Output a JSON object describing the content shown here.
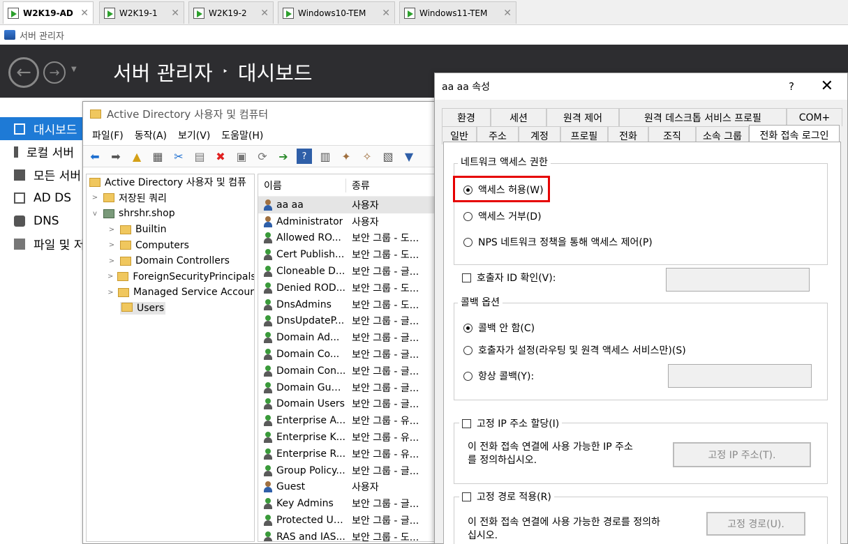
{
  "vm_tabs": [
    {
      "label": "W2K19-AD"
    },
    {
      "label": "W2K19-1"
    },
    {
      "label": "W2K19-2"
    },
    {
      "label": "Windows10-TEM"
    },
    {
      "label": "Windows11-TEM"
    }
  ],
  "server_manager": {
    "window_title": "서버 관리자",
    "header_app": "서버 관리자",
    "header_sep": "‣",
    "header_page": "대시보드",
    "nav": [
      {
        "label": "대시보드"
      },
      {
        "label": "로컬 서버"
      },
      {
        "label": "모든 서버"
      },
      {
        "label": "AD DS"
      },
      {
        "label": "DNS"
      },
      {
        "label": "파일 및 저"
      }
    ]
  },
  "aduc": {
    "title": "Active Directory 사용자 및 컴퓨터",
    "menu": [
      "파일(F)",
      "동작(A)",
      "보기(V)",
      "도움말(H)"
    ],
    "tree": [
      {
        "label": "Active Directory 사용자 및 컴퓨",
        "indent": 0,
        "chevron": ""
      },
      {
        "label": "저장된 쿼리",
        "indent": 1,
        "chevron": ">"
      },
      {
        "label": "shrshr.shop",
        "indent": 1,
        "chevron": "v"
      },
      {
        "label": "Builtin",
        "indent": 2,
        "chevron": ">"
      },
      {
        "label": "Computers",
        "indent": 2,
        "chevron": ">"
      },
      {
        "label": "Domain Controllers",
        "indent": 2,
        "chevron": ">"
      },
      {
        "label": "ForeignSecurityPrincipals",
        "indent": 2,
        "chevron": ">"
      },
      {
        "label": "Managed Service Accour",
        "indent": 2,
        "chevron": ">"
      },
      {
        "label": "Users",
        "indent": 2,
        "chevron": ""
      }
    ],
    "columns": {
      "name": "이름",
      "type": "종류"
    },
    "rows": [
      {
        "name": "aa aa",
        "type": "사용자",
        "kind": "user"
      },
      {
        "name": "Administrator",
        "type": "사용자",
        "kind": "user"
      },
      {
        "name": "Allowed RO...",
        "type": "보안 그룹 - 도...",
        "kind": "group"
      },
      {
        "name": "Cert Publish...",
        "type": "보안 그룹 - 도...",
        "kind": "group"
      },
      {
        "name": "Cloneable D...",
        "type": "보안 그룹 - 글...",
        "kind": "group"
      },
      {
        "name": "Denied ROD...",
        "type": "보안 그룹 - 도...",
        "kind": "group"
      },
      {
        "name": "DnsAdmins",
        "type": "보안 그룹 - 도...",
        "kind": "group"
      },
      {
        "name": "DnsUpdateP...",
        "type": "보안 그룹 - 글...",
        "kind": "group"
      },
      {
        "name": "Domain Ad...",
        "type": "보안 그룹 - 글...",
        "kind": "group"
      },
      {
        "name": "Domain Co...",
        "type": "보안 그룹 - 글...",
        "kind": "group"
      },
      {
        "name": "Domain Con...",
        "type": "보안 그룹 - 글...",
        "kind": "group"
      },
      {
        "name": "Domain Gue...",
        "type": "보안 그룹 - 글...",
        "kind": "group"
      },
      {
        "name": "Domain Users",
        "type": "보안 그룹 - 글...",
        "kind": "group"
      },
      {
        "name": "Enterprise A...",
        "type": "보안 그룹 - 유...",
        "kind": "group"
      },
      {
        "name": "Enterprise K...",
        "type": "보안 그룹 - 유...",
        "kind": "group"
      },
      {
        "name": "Enterprise R...",
        "type": "보안 그룹 - 유...",
        "kind": "group"
      },
      {
        "name": "Group Policy...",
        "type": "보안 그룹 - 글...",
        "kind": "group"
      },
      {
        "name": "Guest",
        "type": "사용자",
        "kind": "user"
      },
      {
        "name": "Key Admins",
        "type": "보안 그룹 - 글...",
        "kind": "group"
      },
      {
        "name": "Protected Us...",
        "type": "보안 그룹 - 글...",
        "kind": "group"
      },
      {
        "name": "RAS and IAS...",
        "type": "보안 그룹 - 도...",
        "kind": "group"
      }
    ]
  },
  "dialog": {
    "title": "aa aa 속성",
    "help": "?",
    "close": "✕",
    "tabs_row1": [
      "환경",
      "세션",
      "원격 제어",
      "원격 데스크톱 서비스 프로필",
      "COM+"
    ],
    "tabs_row2": [
      "일반",
      "주소",
      "계정",
      "프로필",
      "전화",
      "조직",
      "소속 그룹",
      "전화 접속 로그인"
    ],
    "network_access": {
      "legend": "네트워크 액세스 권한",
      "allow": "액세스 허용(W)",
      "deny": "액세스 거부(D)",
      "nps": "NPS 네트워크 정책을 통해 액세스 제어(P)"
    },
    "caller_id": "호출자 ID 확인(V):",
    "callback": {
      "legend": "콜백 옵션",
      "none": "콜백 안 함(C)",
      "caller_set": "호출자가 설정(라우팅 및 원격 액세스 서비스만)(S)",
      "always": "항상 콜백(Y):"
    },
    "static_ip": {
      "legend": "고정 IP 주소 할당(I)",
      "desc1": "이 전화 접속 연결에 사용 가능한 IP 주소",
      "desc2": "를 정의하십시오.",
      "button": "고정 IP 주소(T)."
    },
    "static_route": {
      "legend": "고정 경로 적용(R)",
      "desc1": "이 전화 접속 연결에 사용 가능한 경로를 정의하",
      "desc2": "십시오.",
      "button": "고정 경로(U)."
    }
  }
}
